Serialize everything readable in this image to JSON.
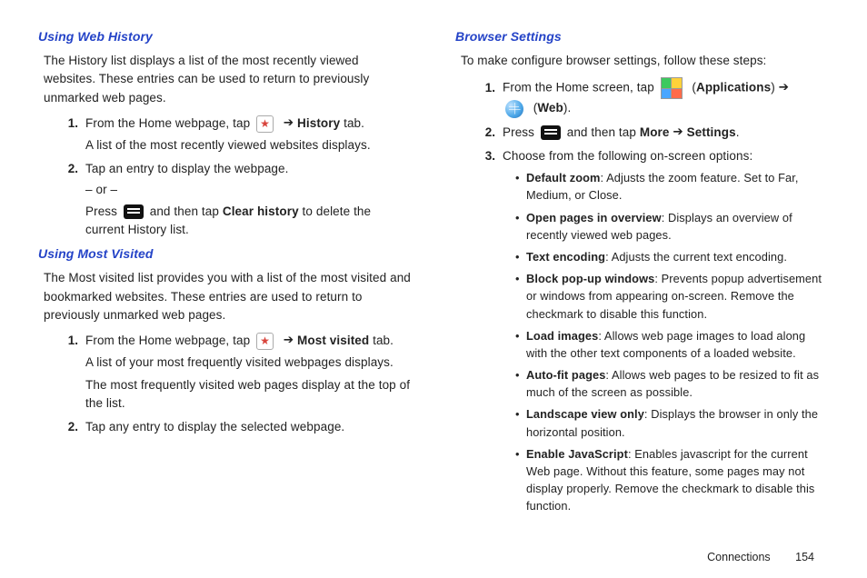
{
  "left": {
    "s1": {
      "heading": "Using Web History",
      "intro": "The History list displays a list of the most recently viewed websites. These entries can be used to return to previously unmarked web pages.",
      "step1a": "From the Home webpage, tap ",
      "step1b": "History",
      "step1c": " tab.",
      "step1sub": "A list of the most recently viewed websites displays.",
      "step2": "Tap an entry to display the webpage.",
      "or": "– or –",
      "step2b_pre": "Press ",
      "step2b_mid": " and then tap ",
      "step2b_bold": "Clear history",
      "step2b_post": " to delete the current History list."
    },
    "s2": {
      "heading": "Using Most Visited",
      "intro": "The Most visited list provides you with a list of the most visited and bookmarked websites. These entries are used to return to previously unmarked web pages.",
      "step1a": "From the Home webpage, tap ",
      "step1b": "Most visited",
      "step1c": " tab.",
      "step1sub1": "A list of your most frequently visited webpages displays.",
      "step1sub2": "The most frequently visited web pages display at the top of the list.",
      "step2": "Tap any entry to display the selected webpage."
    }
  },
  "right": {
    "heading": "Browser Settings",
    "intro": "To make configure browser settings, follow these steps:",
    "step1_a": "From the Home screen, tap ",
    "step1_apps": "Applications",
    "step1_web": "Web",
    "step2_pre": "Press ",
    "step2_mid": " and then tap ",
    "step2_more": "More",
    "step2_settings": "Settings",
    "step3": "Choose from the following on-screen options:",
    "opts": [
      {
        "b": "Default zoom",
        "t": ": Adjusts the zoom feature. Set to Far, Medium, or Close."
      },
      {
        "b": "Open pages in overview",
        "t": ": Displays an overview of recently viewed web pages."
      },
      {
        "b": "Text encoding",
        "t": ": Adjusts the current text encoding."
      },
      {
        "b": "Block pop-up windows",
        "t": ": Prevents popup advertisement or windows from appearing on-screen. Remove the checkmark to disable this function."
      },
      {
        "b": "Load images",
        "t": ": Allows web page images to load along with the other text components of a loaded website."
      },
      {
        "b": "Auto-fit pages",
        "t": ": Allows web pages to be resized to fit as much of the screen as possible."
      },
      {
        "b": "Landscape view only",
        "t": ": Displays the browser in only the horizontal position."
      },
      {
        "b": "Enable JavaScript",
        "t": ": Enables javascript for the current Web page. Without this feature, some pages may not display properly. Remove the checkmark to disable this function."
      }
    ]
  },
  "footer": {
    "section": "Connections",
    "page": "154"
  },
  "arrow": "➔"
}
